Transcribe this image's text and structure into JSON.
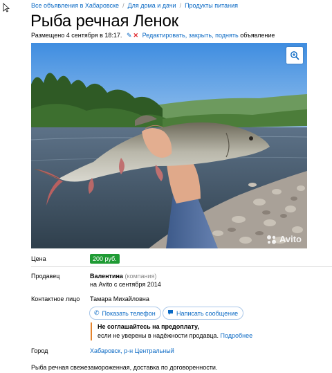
{
  "breadcrumbs": [
    {
      "label": "Все объявления в Хабаровске"
    },
    {
      "label": "Для дома и дачи"
    },
    {
      "label": "Продукты питания"
    }
  ],
  "title": "Рыба речная Ленок",
  "meta": {
    "posted": "Размещено 4 сентября в 18:17.",
    "edit_link": "Редактировать, закрыть, поднять",
    "edit_suffix": "объявление"
  },
  "photo": {
    "watermark": "Avito",
    "zoom_icon": "magnifier-plus-icon"
  },
  "price": {
    "label": "Цена",
    "value": "200 руб."
  },
  "seller": {
    "label": "Продавец",
    "name": "Валентина",
    "type": "(компания)",
    "since": "на Avito с сентября 2014"
  },
  "contact": {
    "label": "Контактное лицо",
    "name": "Тамара Михайловна",
    "show_phone": "Показать телефон",
    "write_message": "Написать сообщение"
  },
  "warning": {
    "title": "Не соглашайтесь на предоплату,",
    "text": "если не уверены в надёжности продавца.",
    "more": "Подробнее"
  },
  "city": {
    "label": "Город",
    "value": "Хабаровск, р-н Центральный"
  },
  "description": "Рыба речная свежезамороженная, доставка по договоренности.",
  "colors": {
    "link": "#0a69c4",
    "price_badge": "#1f9b34",
    "warning_border": "#e4822b"
  }
}
